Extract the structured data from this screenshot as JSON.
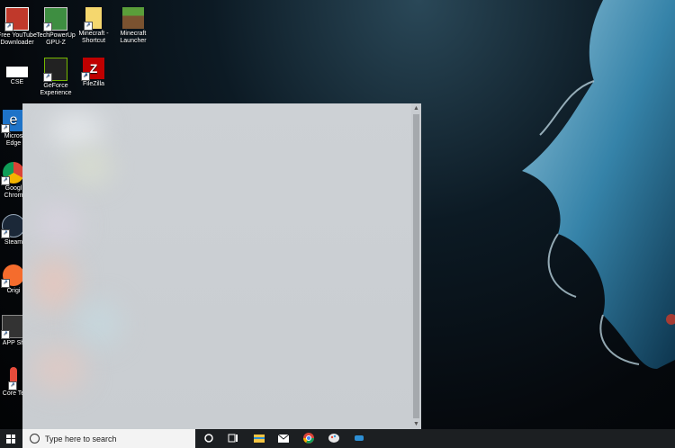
{
  "desktop": {
    "icons": [
      {
        "label_line1": "Free YouTube",
        "label_line2": "Downloader"
      },
      {
        "label_line1": "TechPowerUp",
        "label_line2": "GPU-Z"
      },
      {
        "label_line1": "Minecraft -",
        "label_line2": "Shortcut"
      },
      {
        "label_line1": "Minecraft",
        "label_line2": "Launcher"
      },
      {
        "label_line1": "CSE",
        "label_line2": ""
      },
      {
        "label_line1": "GeForce",
        "label_line2": "Experience"
      },
      {
        "label_line1": "FileZilla",
        "label_line2": ""
      },
      {
        "label_line1": "Micros",
        "label_line2": "Edge"
      },
      {
        "label_line1": "Googl",
        "label_line2": "Chrom"
      },
      {
        "label_line1": "Steam",
        "label_line2": ""
      },
      {
        "label_line1": "Origi",
        "label_line2": ""
      },
      {
        "label_line1": "APP Sh",
        "label_line2": ""
      },
      {
        "label_line1": "Core Te",
        "label_line2": ""
      }
    ]
  },
  "taskbar": {
    "search_placeholder": "Type here to search",
    "pinned": [
      "cortana-icon",
      "task-view-icon",
      "file-explorer-icon",
      "mail-icon",
      "chrome-icon",
      "paint-icon",
      "app-icon"
    ]
  },
  "colors": {
    "accent": "#2d8fd5",
    "taskbar": "#1c1f22",
    "start_panel": "#cdd1d5"
  }
}
